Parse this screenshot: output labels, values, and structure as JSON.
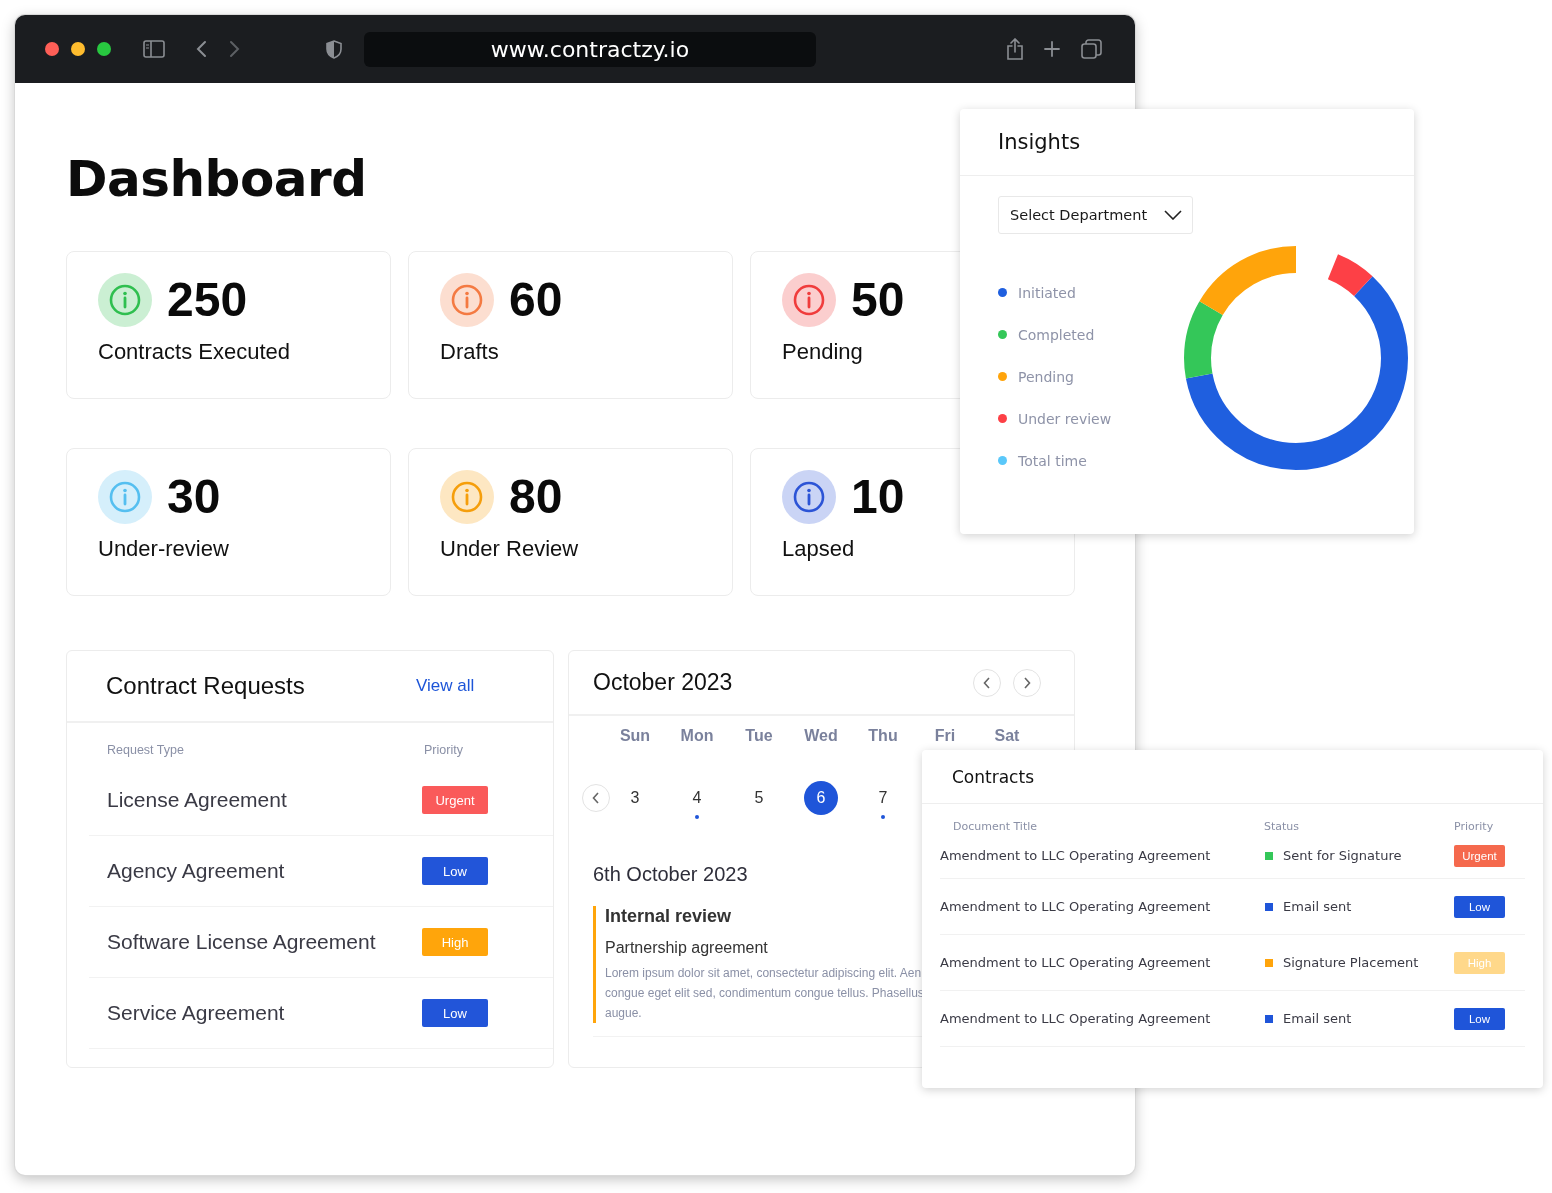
{
  "browser": {
    "url": "www.contractzy.io"
  },
  "page_title": "Dashboard",
  "stats": [
    {
      "value": "250",
      "label": "Contracts Executed",
      "color": "#2fbf4f"
    },
    {
      "value": "60",
      "label": "Drafts",
      "color": "#f47a42"
    },
    {
      "value": "50",
      "label": "Pending",
      "color": "#f03c3c"
    },
    {
      "value": "30",
      "label": "Under-review",
      "color": "#55bff0"
    },
    {
      "value": "80",
      "label": "Under Review",
      "color": "#f59e0b"
    },
    {
      "value": "10",
      "label": "Lapsed",
      "color": "#2c54d6"
    }
  ],
  "contract_requests": {
    "title": "Contract Requests",
    "view_all": "View all",
    "columns": [
      "Request Type",
      "Priority"
    ],
    "rows": [
      {
        "type": "License Agreement",
        "priority": {
          "label": "Urgent",
          "color": "#fa5a5a"
        }
      },
      {
        "type": "Agency Agreement",
        "priority": {
          "label": "Low",
          "color": "#2255d9"
        }
      },
      {
        "type": "Software License Agreement",
        "priority": {
          "label": "High",
          "color": "#ffa50b"
        }
      },
      {
        "type": "Service Agreement",
        "priority": {
          "label": "Low",
          "color": "#2255d9"
        }
      }
    ]
  },
  "calendar": {
    "title": "October 2023",
    "weekdays": [
      "Sun",
      "Mon",
      "Tue",
      "Wed",
      "Thu",
      "Fri",
      "Sat"
    ],
    "days": [
      {
        "date": "3",
        "selected": false,
        "marked": false
      },
      {
        "date": "4",
        "selected": false,
        "marked": true
      },
      {
        "date": "5",
        "selected": false,
        "marked": false
      },
      {
        "date": "6",
        "selected": true,
        "marked": false
      },
      {
        "date": "7",
        "selected": false,
        "marked": true
      }
    ],
    "selected_date": "6th October 2023",
    "event": {
      "title": "Internal review",
      "subtitle": "Partnership agreement",
      "description_lines": [
        "Lorem ipsum dolor sit amet, consectetur adipiscing elit. Aen",
        "congue eget elit sed, condimentum congue tellus. Phasellus",
        "augue."
      ]
    }
  },
  "insights": {
    "title": "Insights",
    "select": "Select Department",
    "legend": [
      {
        "label": "Initiated",
        "color": "#1f5fdf"
      },
      {
        "label": "Completed",
        "color": "#34c759"
      },
      {
        "label": "Pending",
        "color": "#ffa40b"
      },
      {
        "label": "Under review",
        "color": "#fd4046"
      },
      {
        "label": "Total time",
        "color": "#5ac8fa"
      }
    ]
  },
  "contracts": {
    "title": "Contracts",
    "columns": [
      "Document Title",
      "Status",
      "Priority"
    ],
    "rows": [
      {
        "title": "Amendment to LLC Operating Agreement",
        "status": {
          "label": "Sent for Signature",
          "color": "#34c759"
        },
        "priority": {
          "label": "Urgent",
          "color": "#f5694d"
        }
      },
      {
        "title": "Amendment to LLC Operating Agreement",
        "status": {
          "label": "Email sent",
          "color": "#1f55d9"
        },
        "priority": {
          "label": "Low",
          "color": "#1f55d9"
        }
      },
      {
        "title": "Amendment to LLC Operating Agreement",
        "status": {
          "label": "Signature Placement",
          "color": "#ffa40b"
        },
        "priority": {
          "label": "High",
          "color": "#ffd88a"
        }
      },
      {
        "title": "Amendment to LLC Operating Agreement",
        "status": {
          "label": "Email sent",
          "color": "#1f55d9"
        },
        "priority": {
          "label": "Low",
          "color": "#1f55d9"
        }
      }
    ]
  }
}
